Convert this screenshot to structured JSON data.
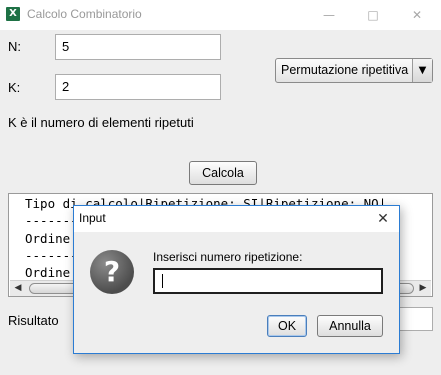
{
  "window": {
    "title": "Calcolo Combinatorio",
    "icon_text": "X",
    "minimize": "—",
    "maximize": "□",
    "close": "✕"
  },
  "form": {
    "n_label": "N:",
    "n_value": "5",
    "k_label": "K:",
    "k_value": "2",
    "hint": "K è il numero di elementi ripetuti",
    "mode_selected": "Permutazione ripetitiva",
    "calc_button": "Calcola",
    "result_label": "Risultato"
  },
  "output": {
    "lines": [
      "Tipo di calcolo|Ripetizione: SI|Ripetizione: NO|",
      "-----------------------------------------------|",
      "Ordine",
      "-----------------------------------------------|",
      "Ordine"
    ]
  },
  "dialog": {
    "title": "Input",
    "message": "Inserisci numero ripetizione:",
    "input_value": "",
    "ok": "OK",
    "cancel": "Annulla",
    "close": "✕",
    "icon_glyph": "?"
  },
  "colors": {
    "accent": "#2b7cd3",
    "excel_green": "#1e7145"
  }
}
